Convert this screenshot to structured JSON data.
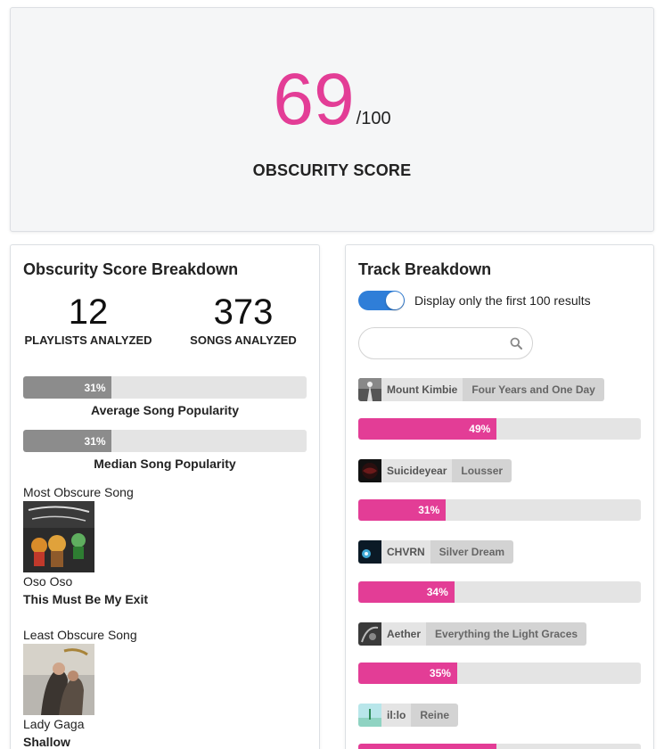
{
  "score": {
    "value": "69",
    "max": "/100",
    "label": "OBSCURITY SCORE",
    "accent_color": "#e33d96"
  },
  "breakdown": {
    "title": "Obscurity Score Breakdown",
    "playlists": {
      "value": "12",
      "label": "PLAYLISTS ANALYZED"
    },
    "songs": {
      "value": "373",
      "label": "SONGS ANALYZED"
    },
    "average_popularity": {
      "percent": 31,
      "text": "31%",
      "label": "Average Song Popularity"
    },
    "median_popularity": {
      "percent": 31,
      "text": "31%",
      "label": "Median Song Popularity"
    },
    "most_obscure": {
      "heading": "Most Obscure Song",
      "artist": "Oso Oso",
      "title": "This Must Be My Exit"
    },
    "least_obscure": {
      "heading": "Least Obscure Song",
      "artist": "Lady Gaga",
      "title": "Shallow"
    }
  },
  "tracks": {
    "title": "Track Breakdown",
    "toggle_label": "Display only the first 100 results",
    "toggle_on": true,
    "search_placeholder": "",
    "items": [
      {
        "artist": "Mount Kimbie",
        "title": "Four Years and One Day",
        "percent": 49,
        "text": "49%"
      },
      {
        "artist": "Suicideyear",
        "title": "Lousser",
        "percent": 31,
        "text": "31%"
      },
      {
        "artist": "CHVRN",
        "title": "Silver Dream",
        "percent": 34,
        "text": "34%"
      },
      {
        "artist": "Aether",
        "title": "Everything the Light Graces",
        "percent": 35,
        "text": "35%"
      },
      {
        "artist": "il:lo",
        "title": "Reine",
        "percent": 49,
        "text": ""
      }
    ]
  }
}
